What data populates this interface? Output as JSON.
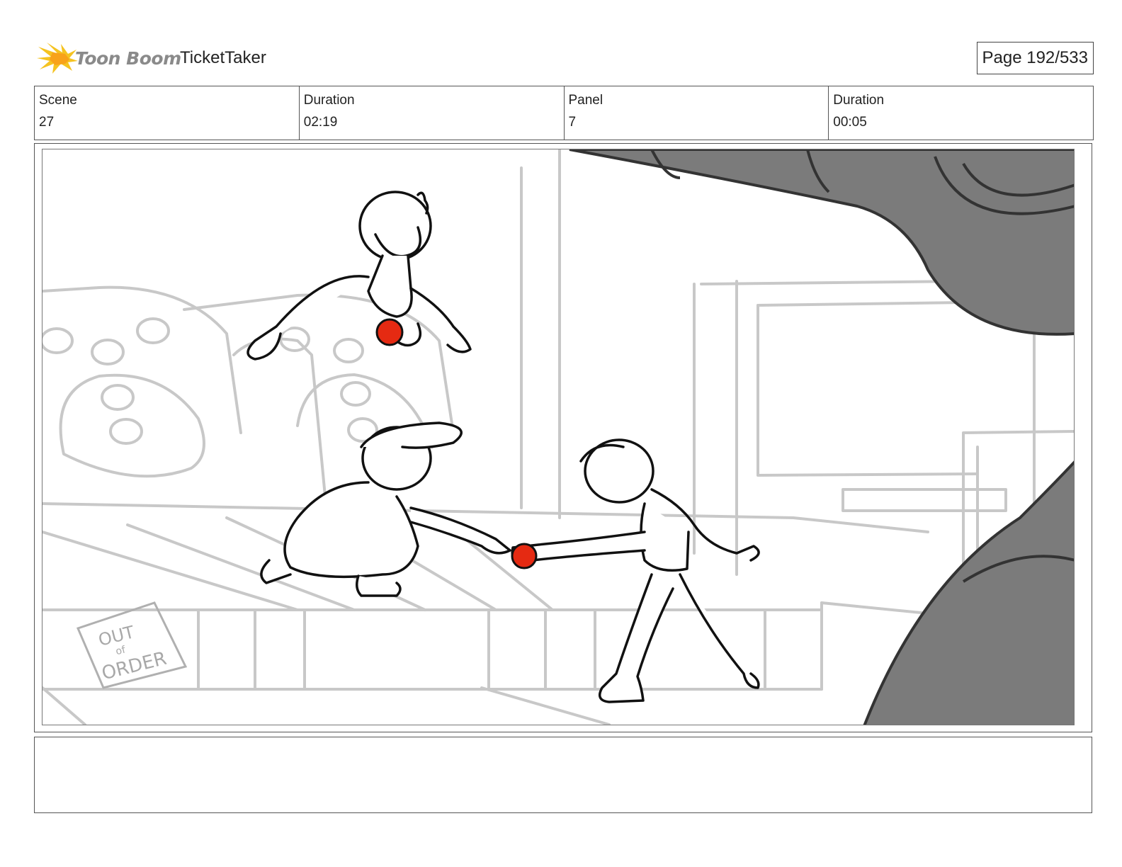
{
  "header": {
    "logo_text": "Toon Boom",
    "project_name": "TicketTaker",
    "page_label": "Page 192/533"
  },
  "info": {
    "scene_label": "Scene",
    "scene_value": "27",
    "scene_duration_label": "Duration",
    "scene_duration_value": "02:19",
    "panel_label": "Panel",
    "panel_value": "7",
    "panel_duration_label": "Duration",
    "panel_duration_value": "00:05"
  },
  "panel": {
    "sign_text": "OUT OF ORDER"
  },
  "notes": {
    "text": ""
  },
  "colors": {
    "accent_red": "#e52a12",
    "shadow_gray": "#7b7b7b",
    "logo_yellow": "#f5c320"
  }
}
